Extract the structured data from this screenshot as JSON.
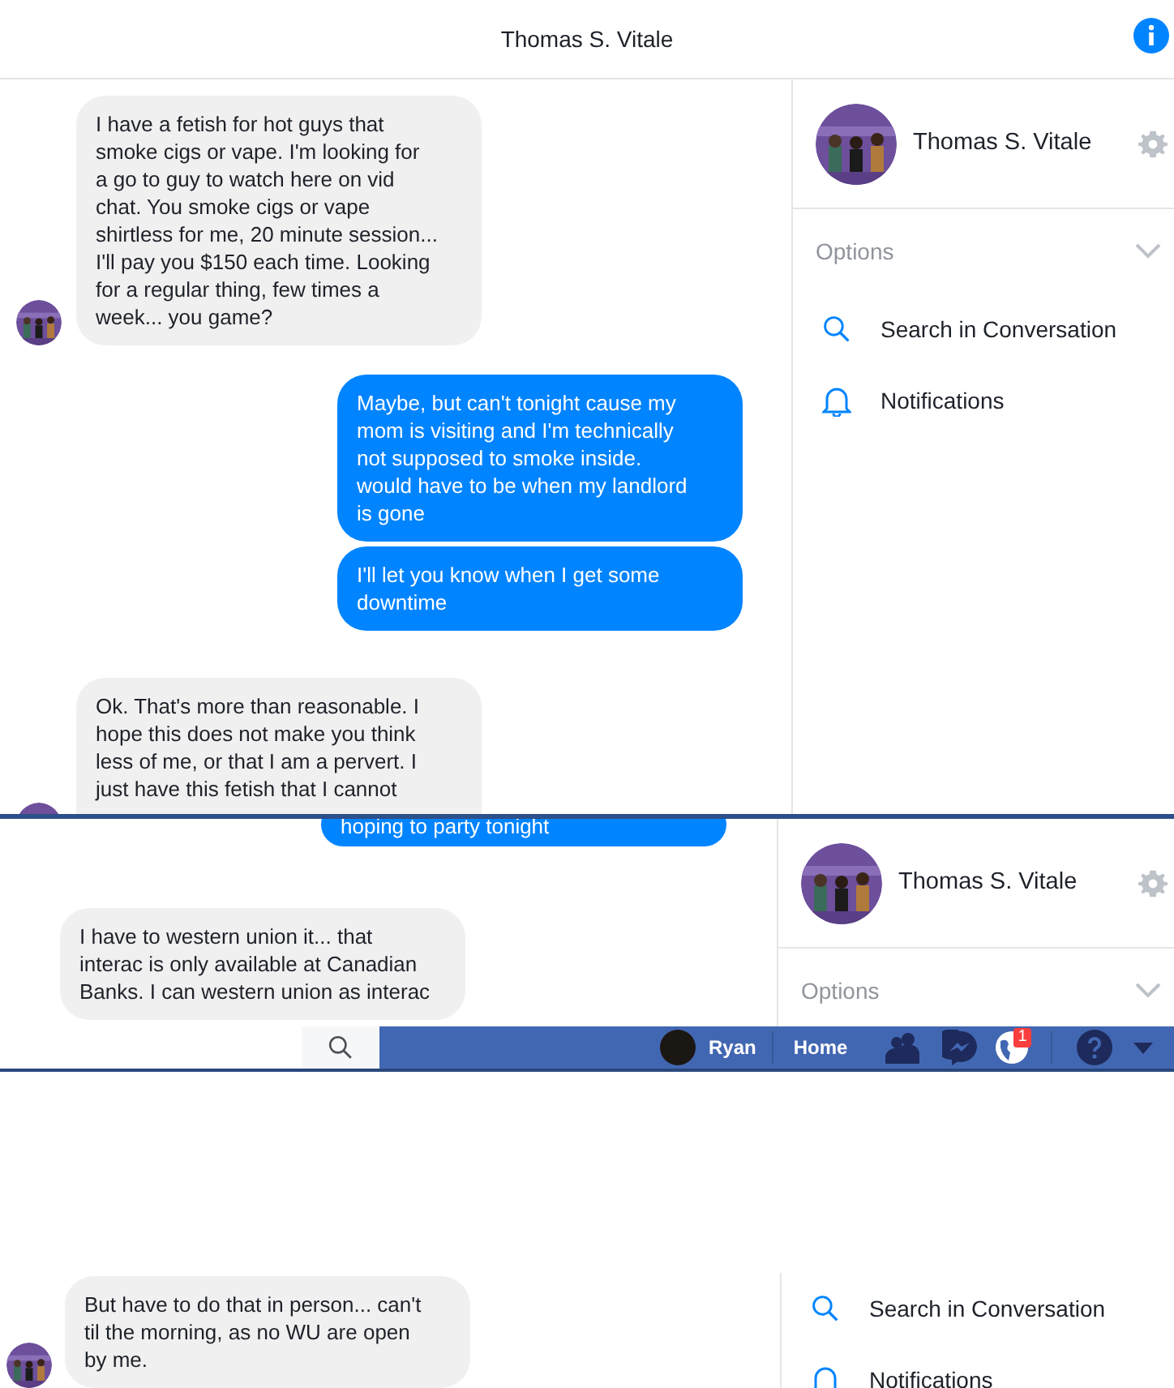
{
  "screenshot_1": {
    "header": {
      "title": "Thomas S. Vitale"
    },
    "messages": [
      {
        "kind": "incoming",
        "avatar": true,
        "text": "I have a fetish for hot guys that\nsmoke cigs or vape. I'm looking for\na go to guy to watch here on vid\nchat. You smoke cigs or vape\nshirtless for me, 20 minute session...\nI'll pay you $150 each time. Looking\nfor a regular thing, few times a\nweek... you game?"
      },
      {
        "kind": "outgoing",
        "avatar": false,
        "text": "Maybe, but can't tonight cause my\nmom is visiting and I'm technically\nnot supposed to smoke inside.\nwould have to be when my landlord\nis gone"
      },
      {
        "kind": "outgoing",
        "avatar": false,
        "text": "I'll let you know when I get some\ndowntime"
      },
      {
        "kind": "incoming",
        "avatar": true,
        "text": "Ok. That's more than reasonable. I\nhope this does not make you think\nless of me, or that I am a pervert. I\njust have this fetish that I cannot"
      }
    ],
    "sidebar": {
      "name": "Thomas S. Vitale",
      "options_label": "Options",
      "actions": [
        {
          "kind": "search",
          "label": "Search in Conversation"
        },
        {
          "kind": "notifications",
          "label": "Notifications"
        }
      ]
    }
  },
  "screenshot_2": {
    "messages": [
      {
        "kind": "outgoing",
        "avatar": false,
        "text": "hoping to party tonight"
      },
      {
        "kind": "incoming",
        "avatar": false,
        "text": "I have to western union it... that\ninterac is only available at Canadian\nBanks. I can western union as interac"
      }
    ],
    "sidebar": {
      "name": "Thomas S. Vitale",
      "options_label": "Options"
    }
  },
  "screenshot_3": {
    "top_bar": {
      "user": "Ryan",
      "home": "Home",
      "notification_badge": "1"
    },
    "messages": [
      {
        "kind": "incoming",
        "avatar": true,
        "text": "But have to do that in person... can't\ntil the morning, as no WU are open\nby me."
      }
    ],
    "sidebar": {
      "actions": [
        {
          "kind": "search",
          "label": "Search in Conversation"
        },
        {
          "kind": "notifications",
          "label": "Notifications"
        }
      ]
    }
  }
}
